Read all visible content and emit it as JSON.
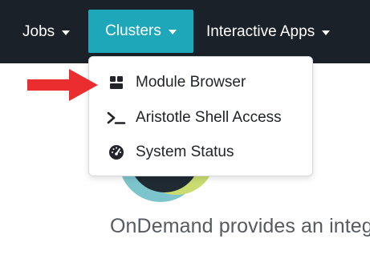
{
  "nav": {
    "jobs_label": "Jobs",
    "clusters_label": "Clusters",
    "interactive_label": "Interactive Apps"
  },
  "dropdown": {
    "items": [
      {
        "label": "Module Browser",
        "icon": "cube-icon"
      },
      {
        "label": "Aristotle Shell Access",
        "icon": "terminal-icon"
      },
      {
        "label": "System Status",
        "icon": "gauge-icon"
      }
    ]
  },
  "main": {
    "tagline": "OnDemand provides an integ"
  },
  "colors": {
    "navbar_bg": "#1b2129",
    "active_nav_bg": "#1da7b9",
    "arrow": "#ea2d2f",
    "tagline": "#555b60"
  }
}
